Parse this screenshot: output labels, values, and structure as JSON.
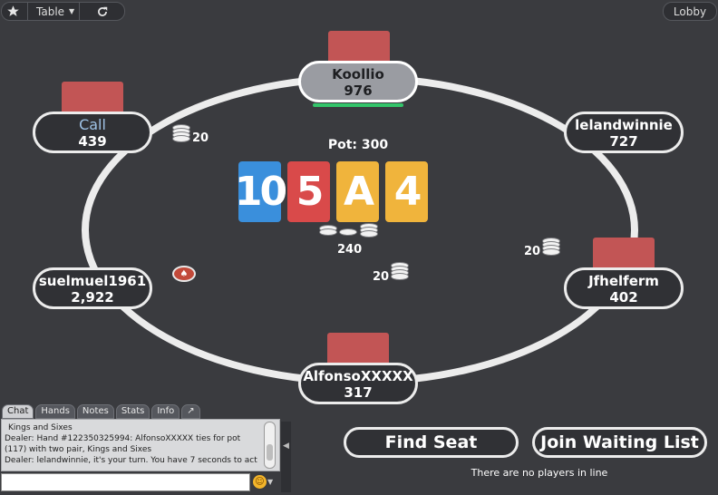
{
  "toolbar": {
    "star_icon": "star-icon",
    "table_label": "Table",
    "refresh_icon": "refresh-icon",
    "lobby_label": "Lobby"
  },
  "seats": [
    {
      "name": "Koollio",
      "stack": "976",
      "active": true
    },
    {
      "name": "Call",
      "stack": "439"
    },
    {
      "name": "lelandwinnie",
      "stack": "727"
    },
    {
      "name": "suelmuel1961",
      "stack": "2,922"
    },
    {
      "name": "Jfhelferm",
      "stack": "402"
    },
    {
      "name": "AlfonsoXXXXX",
      "stack": "317"
    }
  ],
  "pot": "Pot: 300",
  "board": [
    {
      "rank": "10",
      "color": "#3a8fdc"
    },
    {
      "rank": "5",
      "color": "#d94a4a"
    },
    {
      "rank": "A",
      "color": "#f0b43c"
    },
    {
      "rank": "4",
      "color": "#f0b43c"
    }
  ],
  "bets": {
    "call_bet": "20",
    "center_bet": "240",
    "jfhelferm_bet": "20",
    "alfonso_bet": "20"
  },
  "chat": {
    "tabs": [
      "Chat",
      "Hands",
      "Notes",
      "Stats",
      "Info",
      "↗"
    ],
    "lines": [
      "Kings and Sixes",
      "Dealer: Hand #122350325994: AlfonsoXXXXX ties for pot (117) with two pair, Kings and Sixes",
      "Dealer: lelandwinnie, it's your turn. You have 7 seconds to act"
    ],
    "input_value": ""
  },
  "actions": {
    "find_seat": "Find Seat",
    "join_waiting_list": "Join Waiting List",
    "waiting_note": "There are no players in line"
  }
}
